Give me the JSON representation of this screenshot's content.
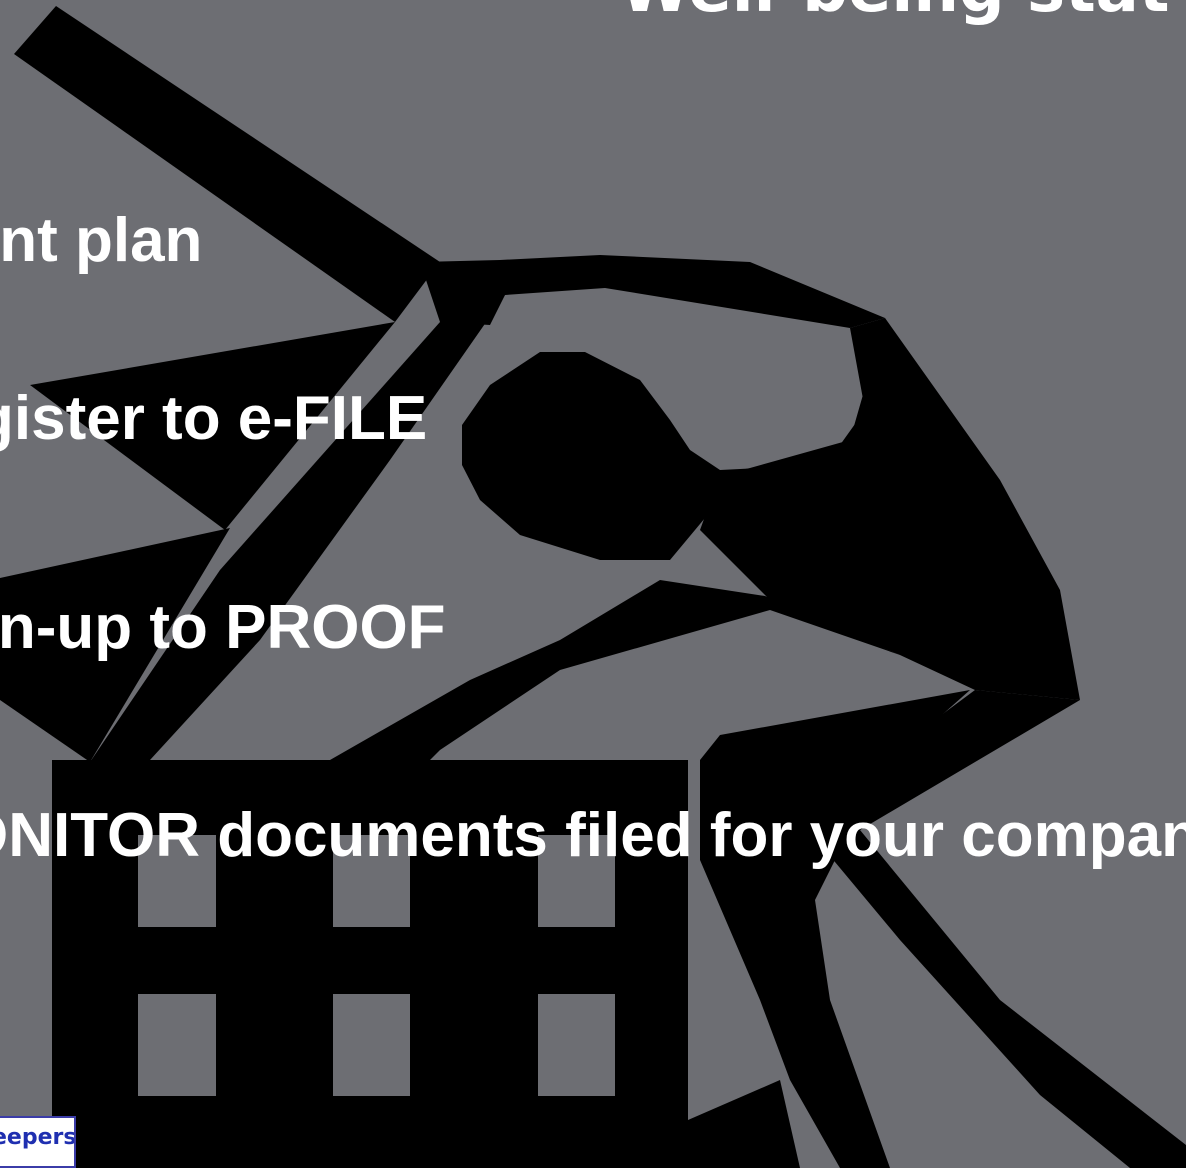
{
  "slide": {
    "heading": "Well-being stat",
    "bullets": [
      "int plan",
      "gister to e-FILE",
      "gn-up to PROOF",
      "ONITOR documents filed for your company"
    ],
    "brand_label": "eepers"
  },
  "colors": {
    "background": "#6d6e73",
    "silhouette": "#000000",
    "text": "#ffffff",
    "brand_text": "#1f2fb0",
    "brand_border": "#3b3ca8"
  },
  "icons": {
    "illustration": "worker-lifting-building-icon"
  }
}
